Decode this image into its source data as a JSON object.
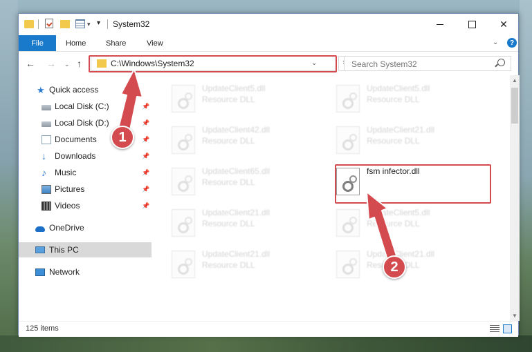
{
  "window": {
    "title": "System32",
    "quick_access_toolbar_dropdown": "▾",
    "customize_glyph": "▾"
  },
  "window_controls": {
    "close": "✕"
  },
  "ribbon": {
    "tabs": [
      "File",
      "Home",
      "Share",
      "View"
    ],
    "collapse_glyph": "⌄",
    "help_glyph": "?"
  },
  "address": {
    "path": "C:\\Windows\\System32",
    "dropdown_glyph": "⌄",
    "refresh_glyph": "↻"
  },
  "search": {
    "placeholder": "Search System32"
  },
  "nav_buttons": {
    "back": "←",
    "forward": "→",
    "recent": "⌄",
    "up": "↑"
  },
  "navigation": {
    "items": [
      {
        "label": "Quick access",
        "icon": "star-icon",
        "pinned": false
      },
      {
        "label": "Local Disk (C:)",
        "icon": "drive-icon",
        "pinned": true
      },
      {
        "label": "Local Disk (D:)",
        "icon": "drive-icon",
        "pinned": true
      },
      {
        "label": "Documents",
        "icon": "documents-icon",
        "pinned": true
      },
      {
        "label": "Downloads",
        "icon": "download-icon",
        "pinned": true
      },
      {
        "label": "Music",
        "icon": "music-icon",
        "pinned": true
      },
      {
        "label": "Pictures",
        "icon": "pictures-icon",
        "pinned": true
      },
      {
        "label": "Videos",
        "icon": "videos-icon",
        "pinned": true
      },
      {
        "label": "OneDrive",
        "icon": "cloud-icon",
        "pinned": false
      },
      {
        "label": "This PC",
        "icon": "computer-icon",
        "pinned": false,
        "selected": true
      },
      {
        "label": "Network",
        "icon": "network-icon",
        "pinned": false
      }
    ],
    "pin_glyph": "📌"
  },
  "files": [
    {
      "name": "UpdateClient5.dll",
      "type": "Resource DLL"
    },
    {
      "name": "UpdateClient5.dll",
      "type": "Resource DLL"
    },
    {
      "name": "UpdateClient42.dll",
      "type": "Resource DLL"
    },
    {
      "name": "UpdateClient21.dll",
      "type": "Resource DLL"
    },
    {
      "name": "UpdateClient65.dll",
      "type": "Resource DLL"
    },
    {
      "name": "fsm infector.dll",
      "type": ""
    },
    {
      "name": "UpdateClient21.dll",
      "type": "Resource DLL"
    },
    {
      "name": "UpdateClient5.dll",
      "type": "Resource DLL"
    },
    {
      "name": "UpdateClient21.dll",
      "type": "Resource DLL"
    },
    {
      "name": "UpdateClient21.dll",
      "type": "Resource DLL"
    }
  ],
  "status": {
    "item_count": "125 items"
  },
  "annotations": {
    "step1": "1",
    "step2": "2",
    "color": "#d44b4f"
  },
  "colors": {
    "accent": "#1979ca",
    "highlight": "#d44b4f",
    "folder": "#f2c94c"
  }
}
